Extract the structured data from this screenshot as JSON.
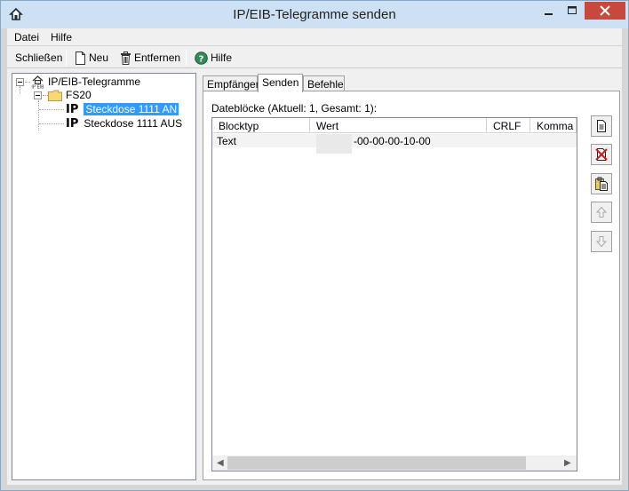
{
  "window": {
    "title": "IP/EIB-Telegramme senden"
  },
  "menu": [
    {
      "label": "Datei"
    },
    {
      "label": "Hilfe"
    }
  ],
  "toolbar": {
    "close_label": "Schließen",
    "new_label": "Neu",
    "remove_label": "Entfernen",
    "help_label": "Hilfe"
  },
  "tree": {
    "root_label": "IP/EIB-Telegramme",
    "folder_label": "FS20",
    "items": [
      {
        "prefix": "IP",
        "label": "Steckdose 1111 AN",
        "selected": true
      },
      {
        "prefix": "IP",
        "label": "Steckdose 1111 AUS",
        "selected": false
      }
    ]
  },
  "tabs": [
    {
      "label": "Empfänger",
      "active": false
    },
    {
      "label": "Senden",
      "active": true
    },
    {
      "label": "Befehle",
      "active": false
    }
  ],
  "panel": {
    "blocks_label": "Dateblöcke (Aktuell: 1, Gesamt: 1):",
    "columns": [
      "Blocktyp",
      "Wert",
      "CRLF",
      "Komma"
    ],
    "rows": [
      {
        "blocktyp": "Text",
        "wert": "-00-00-00-10-00",
        "crlf": "",
        "komma": ""
      }
    ]
  },
  "colors": {
    "selection": "#3399ff",
    "close_button": "#c7483c",
    "titlebar": "#cde0f4"
  }
}
